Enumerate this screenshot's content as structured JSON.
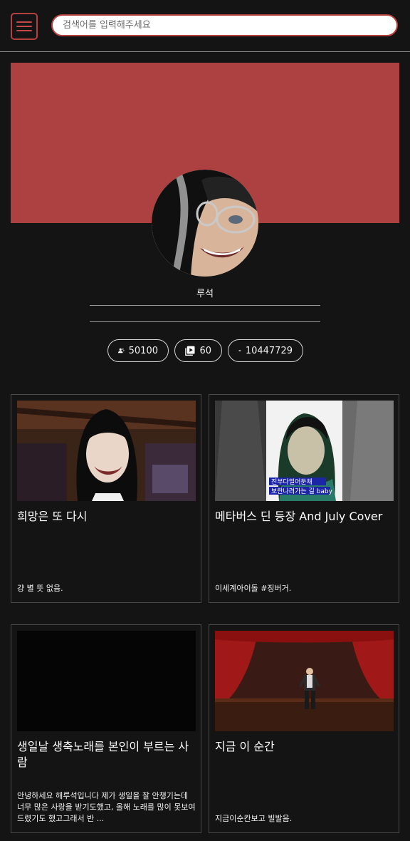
{
  "header": {
    "search_placeholder": "검색어를 입력해주세요"
  },
  "profile": {
    "name": "루석",
    "banner_color": "#ad4040"
  },
  "stats": [
    {
      "icon": "subscribers-icon",
      "value": "50100"
    },
    {
      "icon": "videos-icon",
      "value": "60"
    },
    {
      "icon": "views-icon",
      "value": "10447729"
    }
  ],
  "videos": [
    {
      "title": "희망은 또 다시",
      "description": "걍 별 뜻 없음."
    },
    {
      "title": "메타버스 딘 등장 And July Cover",
      "description": "이세계아이돌 #징버거.",
      "thumbnail_caption": [
        "진부다밀어둔채",
        "보란나려가는 길 baby"
      ]
    },
    {
      "title": "생일날 생축노래를 본인이 부르는 사람",
      "description": "안녕하세요 해루석입니다 제가 생일을 잘 안챙기는데 너무 많은 사랑을 받기도했고, 올해 노래를 많이 못보여드렸기도 했고그래서 반 ..."
    },
    {
      "title": "지금 이 순간",
      "description": "지금이순칸보고 빌발음."
    }
  ],
  "colors": {
    "accent": "#b44040",
    "background": "#141414",
    "card_border": "#4a4a4a"
  }
}
